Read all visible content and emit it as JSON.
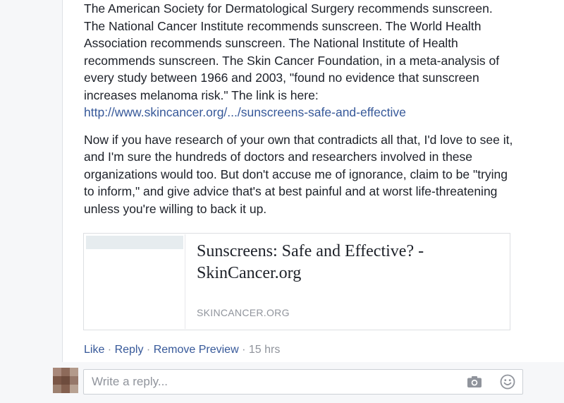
{
  "comment": {
    "paragraph1_text": "The American Society for Dermatological Surgery recommends sunscreen. The National Cancer Institute recommends sunscreen. The World Health Association recommends sunscreen. The National Institute of Health recommends sunscreen. The Skin Cancer Foundation, in a meta-analysis of every study between 1966 and 2003, \"found no evidence that sunscreen increases melanoma risk.\" The link is here:",
    "link_text": "http://www.skincancer.org/.../sunscreens-safe-and-effective",
    "paragraph2_text": "Now if you have research of your own that contradicts all that, I'd love to see it, and I'm sure the hundreds of doctors and researchers involved in these organizations would too. But don't accuse me of ignorance, claim to be \"trying to inform,\" and give advice that's at best painful and at worst life-threatening unless you're willing to back it up."
  },
  "preview": {
    "title": "Sunscreens: Safe and Effective? - SkinCancer.org",
    "domain": "SKINCANCER.ORG"
  },
  "actions": {
    "like": "Like",
    "separator": " · ",
    "reply": "Reply",
    "remove_preview": "Remove Preview",
    "time": "15 hrs"
  },
  "reply_box": {
    "placeholder": "Write a reply..."
  },
  "icons": {
    "camera": "camera-icon",
    "emoji": "smiley-icon"
  },
  "colors": {
    "link": "#365899",
    "meta": "#90949c",
    "text": "#1d2129"
  }
}
